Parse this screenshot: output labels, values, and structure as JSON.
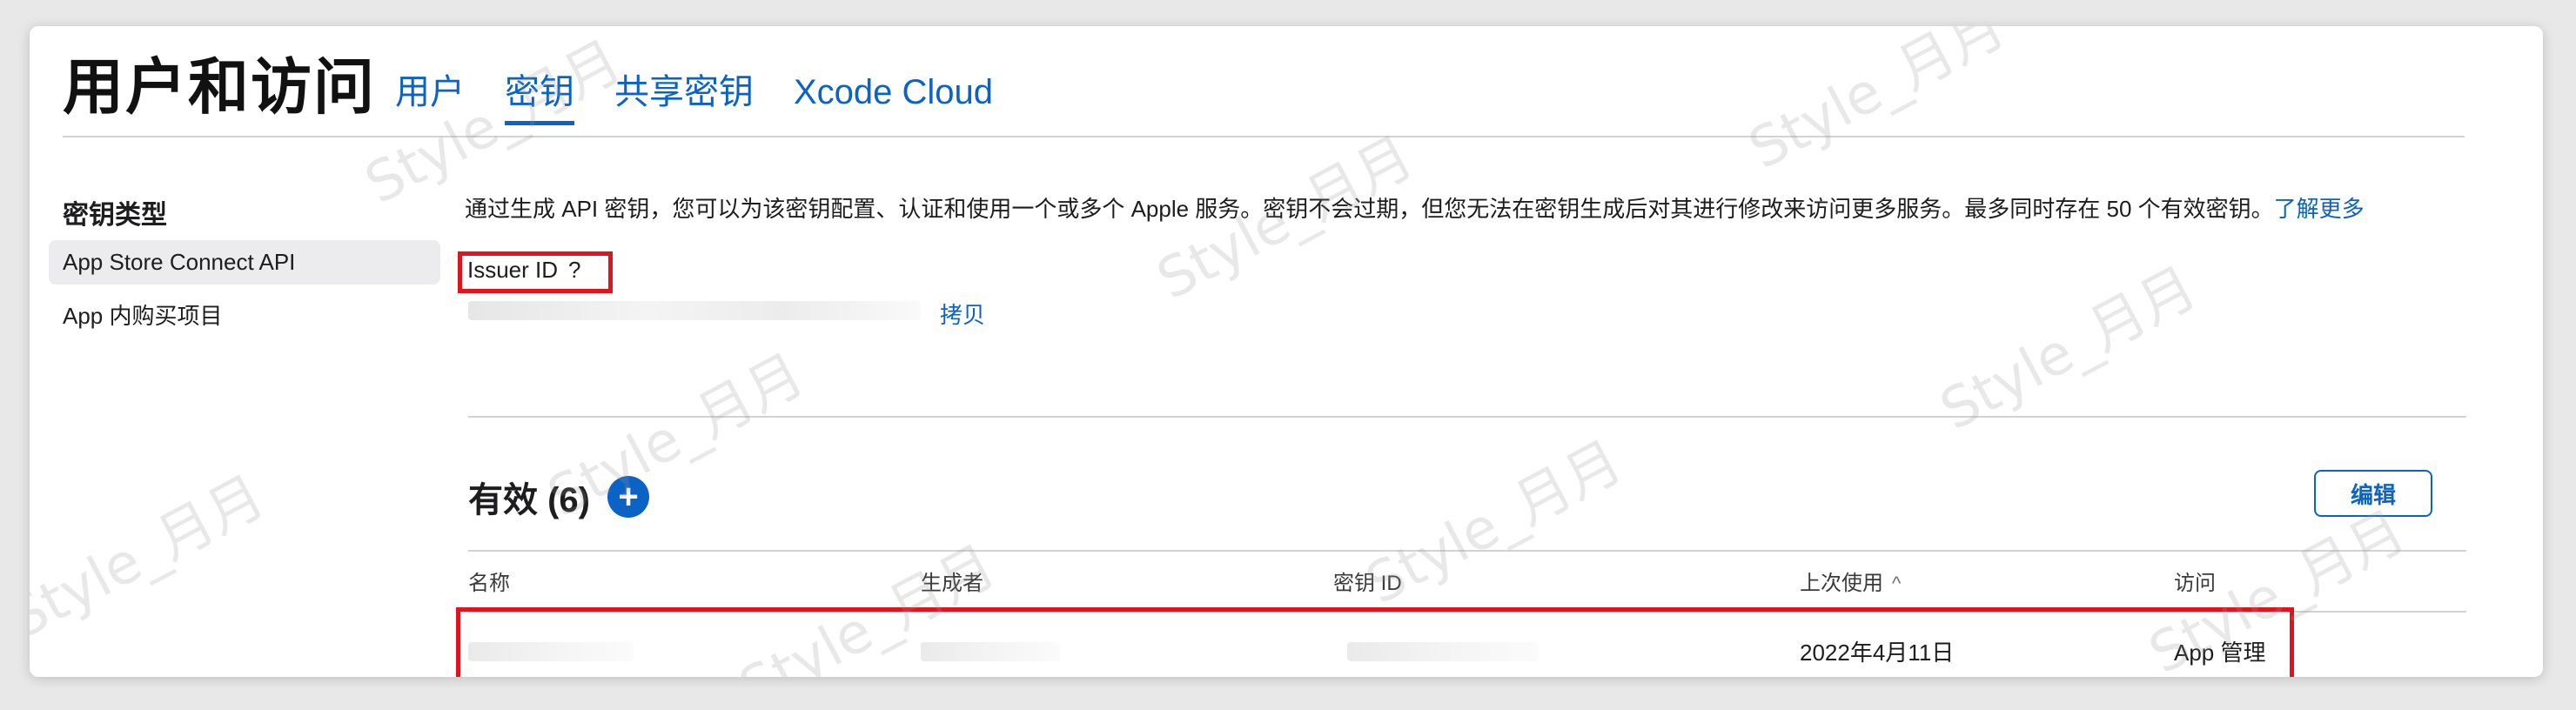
{
  "header": {
    "title": "用户和访问",
    "tabs": [
      {
        "label": "用户",
        "active": false
      },
      {
        "label": "密钥",
        "active": true
      },
      {
        "label": "共享密钥",
        "active": false
      },
      {
        "label": "Xcode Cloud",
        "active": false
      }
    ]
  },
  "sidebar": {
    "heading": "密钥类型",
    "items": [
      {
        "label": "App Store Connect API",
        "selected": true
      },
      {
        "label": "App 内购买项目",
        "selected": false
      }
    ]
  },
  "main": {
    "intro_text": "通过生成 API 密钥，您可以为该密钥配置、认证和使用一个或多个 Apple 服务。密钥不会过期，但您无法在密钥生成后对其进行修改来访问更多服务。最多同时存在 50 个有效密钥。",
    "intro_link": "了解更多",
    "issuer_label": "Issuer ID",
    "issuer_help": "?",
    "copy_label": "拷贝",
    "active_heading": "有效 (6)",
    "add_symbol": "+",
    "edit_label": "编辑",
    "table": {
      "columns": [
        "名称",
        "生成者",
        "密钥 ID",
        "上次使用",
        "访问"
      ],
      "sort_indicator": "^",
      "rows": [
        {
          "last_used": "2022年4月11日",
          "access": "App 管理"
        }
      ]
    }
  },
  "watermark": "Style_月月",
  "colors": {
    "accent": "#0b63c6",
    "highlight": "#e0141f",
    "divider": "#d2d2d7"
  }
}
